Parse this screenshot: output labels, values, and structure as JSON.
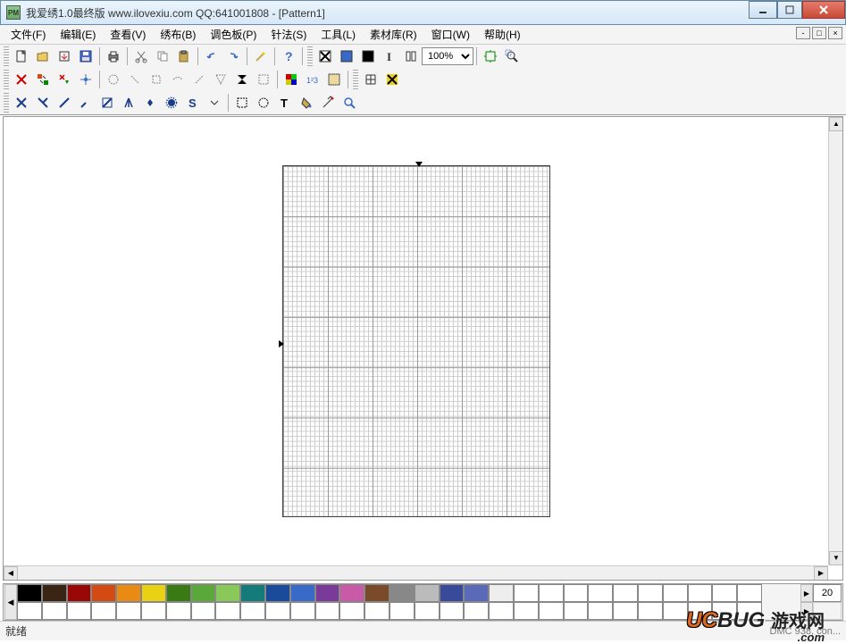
{
  "window": {
    "title": "我爱绣1.0最终版 www.ilovexiu.com QQ:641001808 - [Pattern1]",
    "app_icon_text": "PM"
  },
  "menu": {
    "file": "文件(F)",
    "edit": "编辑(E)",
    "view": "查看(V)",
    "fabric": "绣布(B)",
    "palette": "调色板(P)",
    "stitch": "针法(S)",
    "tool": "工具(L)",
    "material": "素材库(R)",
    "window": "窗口(W)",
    "help": "帮助(H)"
  },
  "toolbar": {
    "zoom": "100%"
  },
  "palette": {
    "count": "20",
    "colors": [
      "#000000",
      "#3a2414",
      "#9a0707",
      "#d34a13",
      "#e98a14",
      "#e9d214",
      "#3a7a14",
      "#5aa83a",
      "#8ac85a",
      "#147a7a",
      "#1a4a9a",
      "#3a6ac8",
      "#7a3a9a",
      "#c85aa8",
      "#7a4a2a",
      "#888888",
      "#bbbbbb",
      "#3a4a9a",
      "#5a6ab8",
      "#eeeeee"
    ],
    "empty_count": 40
  },
  "status": {
    "ready": "就绪",
    "info": "DMC 938, con..."
  },
  "watermark": {
    "uc": "UC",
    "bug": "BUG",
    "cn": "游戏网",
    "com": ".com"
  }
}
